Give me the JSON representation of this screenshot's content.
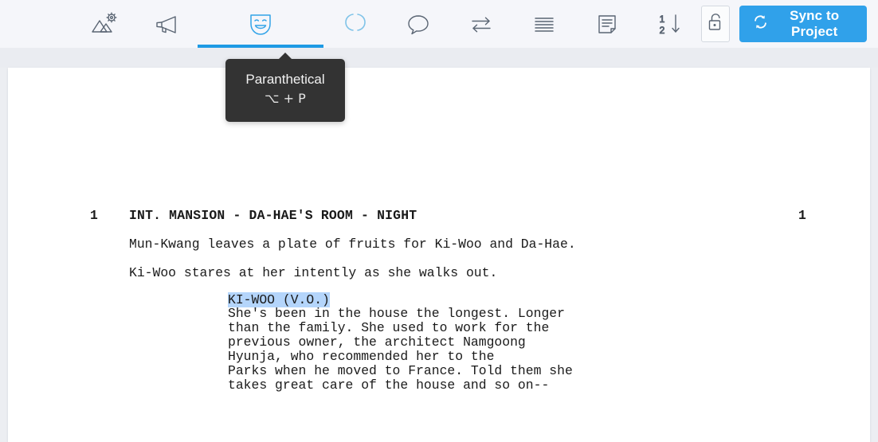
{
  "toolbar": {
    "items": [
      {
        "name": "scene-heading-icon",
        "label": "Scene Heading",
        "icon": "mountains-gear-icon",
        "state": "default"
      },
      {
        "name": "action-icon",
        "label": "Action",
        "icon": "megaphone-icon",
        "state": "default"
      },
      {
        "name": "character-icon",
        "label": "Character",
        "icon": "theater-mask-icon",
        "state": "active"
      },
      {
        "name": "parenthetical-icon",
        "label": "Paranthetical",
        "icon": "parentheses-circle-icon",
        "state": "sub-active"
      },
      {
        "name": "dialogue-icon",
        "label": "Dialogue",
        "icon": "speech-bubble-icon",
        "state": "default"
      },
      {
        "name": "transition-icon",
        "label": "Transition",
        "icon": "two-way-arrows-icon",
        "state": "default"
      },
      {
        "name": "general-icon",
        "label": "General",
        "icon": "lines-icon",
        "state": "default"
      },
      {
        "name": "note-icon",
        "label": "Note",
        "icon": "note-page-icon",
        "state": "default"
      },
      {
        "name": "numbering-icon",
        "label": "Numbering",
        "icon": "numbered-list-down-icon",
        "state": "default"
      }
    ],
    "lock": {
      "label": "Lock",
      "icon": "unlocked-padlock-icon"
    },
    "sync": {
      "label": "Sync to Project",
      "icon": "sync-refresh-icon",
      "color": "#30a1ea"
    }
  },
  "tooltip": {
    "title": "Paranthetical",
    "shortcut": "⌥ + P"
  },
  "script": {
    "scene": {
      "number_left": "1",
      "number_right": "1",
      "heading": "INT. MANSION - DA-HAE'S ROOM - NIGHT"
    },
    "action_1": "Mun-Kwang leaves a plate of fruits for Ki-Woo and Da-Hae.",
    "action_2": "Ki-Woo stares at her intently as she walks out.",
    "character": "KI-WOO (V.O.)",
    "dialogue": "She's been in the house the longest. Longer\nthan the family. She used to work for the\nprevious owner, the architect Namgoong\nHyunja, who recommended her to the\nParks when he moved to France. Told them she\ntakes great care of the house and so on--",
    "selection_color": "#b4d5fb"
  }
}
